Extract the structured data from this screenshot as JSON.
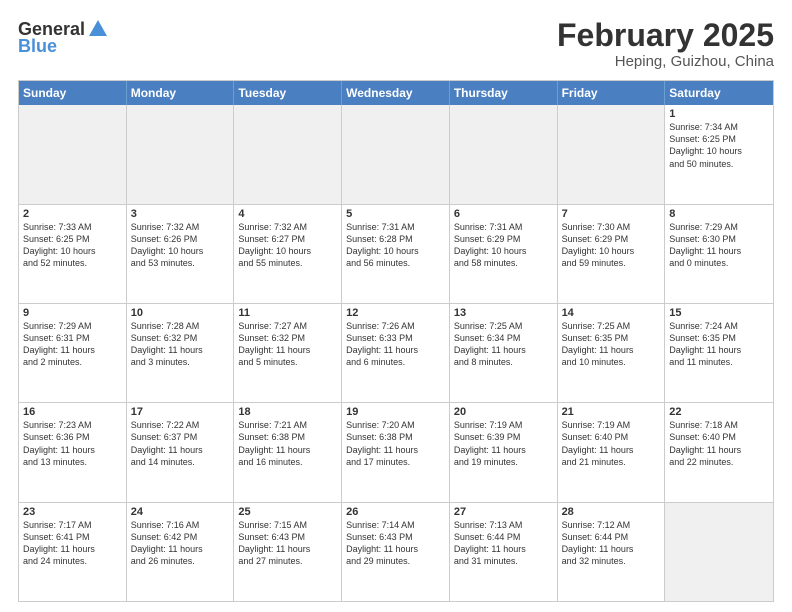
{
  "header": {
    "logo_line1": "General",
    "logo_line2": "Blue",
    "month": "February 2025",
    "location": "Heping, Guizhou, China"
  },
  "weekdays": [
    "Sunday",
    "Monday",
    "Tuesday",
    "Wednesday",
    "Thursday",
    "Friday",
    "Saturday"
  ],
  "rows": [
    [
      {
        "day": "",
        "text": "",
        "shaded": true
      },
      {
        "day": "",
        "text": "",
        "shaded": true
      },
      {
        "day": "",
        "text": "",
        "shaded": true
      },
      {
        "day": "",
        "text": "",
        "shaded": true
      },
      {
        "day": "",
        "text": "",
        "shaded": true
      },
      {
        "day": "",
        "text": "",
        "shaded": true
      },
      {
        "day": "1",
        "text": "Sunrise: 7:34 AM\nSunset: 6:25 PM\nDaylight: 10 hours\nand 50 minutes.",
        "shaded": false
      }
    ],
    [
      {
        "day": "2",
        "text": "Sunrise: 7:33 AM\nSunset: 6:25 PM\nDaylight: 10 hours\nand 52 minutes.",
        "shaded": false
      },
      {
        "day": "3",
        "text": "Sunrise: 7:32 AM\nSunset: 6:26 PM\nDaylight: 10 hours\nand 53 minutes.",
        "shaded": false
      },
      {
        "day": "4",
        "text": "Sunrise: 7:32 AM\nSunset: 6:27 PM\nDaylight: 10 hours\nand 55 minutes.",
        "shaded": false
      },
      {
        "day": "5",
        "text": "Sunrise: 7:31 AM\nSunset: 6:28 PM\nDaylight: 10 hours\nand 56 minutes.",
        "shaded": false
      },
      {
        "day": "6",
        "text": "Sunrise: 7:31 AM\nSunset: 6:29 PM\nDaylight: 10 hours\nand 58 minutes.",
        "shaded": false
      },
      {
        "day": "7",
        "text": "Sunrise: 7:30 AM\nSunset: 6:29 PM\nDaylight: 10 hours\nand 59 minutes.",
        "shaded": false
      },
      {
        "day": "8",
        "text": "Sunrise: 7:29 AM\nSunset: 6:30 PM\nDaylight: 11 hours\nand 0 minutes.",
        "shaded": false
      }
    ],
    [
      {
        "day": "9",
        "text": "Sunrise: 7:29 AM\nSunset: 6:31 PM\nDaylight: 11 hours\nand 2 minutes.",
        "shaded": false
      },
      {
        "day": "10",
        "text": "Sunrise: 7:28 AM\nSunset: 6:32 PM\nDaylight: 11 hours\nand 3 minutes.",
        "shaded": false
      },
      {
        "day": "11",
        "text": "Sunrise: 7:27 AM\nSunset: 6:32 PM\nDaylight: 11 hours\nand 5 minutes.",
        "shaded": false
      },
      {
        "day": "12",
        "text": "Sunrise: 7:26 AM\nSunset: 6:33 PM\nDaylight: 11 hours\nand 6 minutes.",
        "shaded": false
      },
      {
        "day": "13",
        "text": "Sunrise: 7:25 AM\nSunset: 6:34 PM\nDaylight: 11 hours\nand 8 minutes.",
        "shaded": false
      },
      {
        "day": "14",
        "text": "Sunrise: 7:25 AM\nSunset: 6:35 PM\nDaylight: 11 hours\nand 10 minutes.",
        "shaded": false
      },
      {
        "day": "15",
        "text": "Sunrise: 7:24 AM\nSunset: 6:35 PM\nDaylight: 11 hours\nand 11 minutes.",
        "shaded": false
      }
    ],
    [
      {
        "day": "16",
        "text": "Sunrise: 7:23 AM\nSunset: 6:36 PM\nDaylight: 11 hours\nand 13 minutes.",
        "shaded": false
      },
      {
        "day": "17",
        "text": "Sunrise: 7:22 AM\nSunset: 6:37 PM\nDaylight: 11 hours\nand 14 minutes.",
        "shaded": false
      },
      {
        "day": "18",
        "text": "Sunrise: 7:21 AM\nSunset: 6:38 PM\nDaylight: 11 hours\nand 16 minutes.",
        "shaded": false
      },
      {
        "day": "19",
        "text": "Sunrise: 7:20 AM\nSunset: 6:38 PM\nDaylight: 11 hours\nand 17 minutes.",
        "shaded": false
      },
      {
        "day": "20",
        "text": "Sunrise: 7:19 AM\nSunset: 6:39 PM\nDaylight: 11 hours\nand 19 minutes.",
        "shaded": false
      },
      {
        "day": "21",
        "text": "Sunrise: 7:19 AM\nSunset: 6:40 PM\nDaylight: 11 hours\nand 21 minutes.",
        "shaded": false
      },
      {
        "day": "22",
        "text": "Sunrise: 7:18 AM\nSunset: 6:40 PM\nDaylight: 11 hours\nand 22 minutes.",
        "shaded": false
      }
    ],
    [
      {
        "day": "23",
        "text": "Sunrise: 7:17 AM\nSunset: 6:41 PM\nDaylight: 11 hours\nand 24 minutes.",
        "shaded": false
      },
      {
        "day": "24",
        "text": "Sunrise: 7:16 AM\nSunset: 6:42 PM\nDaylight: 11 hours\nand 26 minutes.",
        "shaded": false
      },
      {
        "day": "25",
        "text": "Sunrise: 7:15 AM\nSunset: 6:43 PM\nDaylight: 11 hours\nand 27 minutes.",
        "shaded": false
      },
      {
        "day": "26",
        "text": "Sunrise: 7:14 AM\nSunset: 6:43 PM\nDaylight: 11 hours\nand 29 minutes.",
        "shaded": false
      },
      {
        "day": "27",
        "text": "Sunrise: 7:13 AM\nSunset: 6:44 PM\nDaylight: 11 hours\nand 31 minutes.",
        "shaded": false
      },
      {
        "day": "28",
        "text": "Sunrise: 7:12 AM\nSunset: 6:44 PM\nDaylight: 11 hours\nand 32 minutes.",
        "shaded": false
      },
      {
        "day": "",
        "text": "",
        "shaded": true
      }
    ]
  ]
}
